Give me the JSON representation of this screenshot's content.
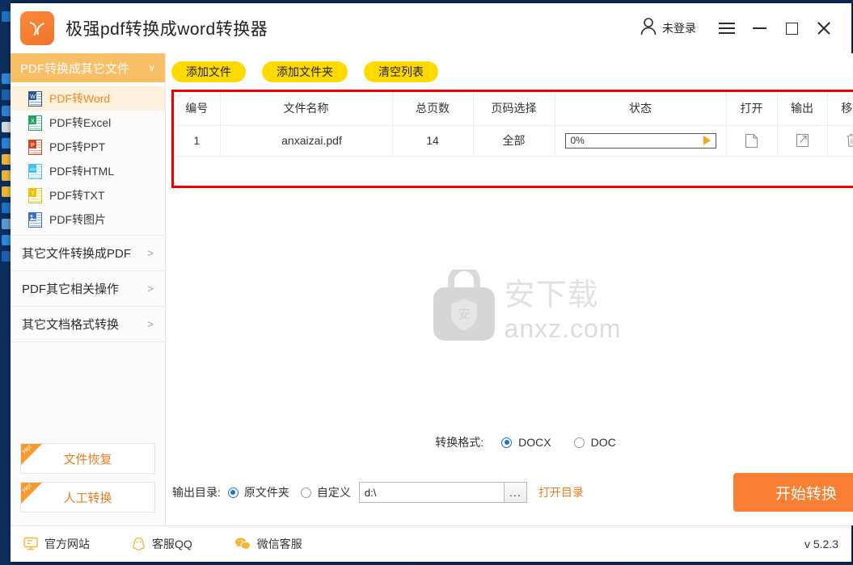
{
  "window": {
    "title": "极强pdf转换成word转换器",
    "login_text": "未登录",
    "version": "v 5.2.3"
  },
  "titlebar_controls": {
    "user_icon": "user-icon",
    "menu_icon": "hamburger-icon",
    "minimize_icon": "minimize-icon",
    "maximize_icon": "maximize-icon",
    "close_icon": "close-icon"
  },
  "sidebar": {
    "header": {
      "label": "PDF转换成其它文件",
      "chevron": "∨"
    },
    "sub_items": [
      {
        "label": "PDF转Word",
        "icon": "word-file-icon",
        "color": "#2b579a",
        "letter": "W",
        "active": true
      },
      {
        "label": "PDF转Excel",
        "icon": "excel-file-icon",
        "color": "#21a366",
        "letter": "X",
        "active": false
      },
      {
        "label": "PDF转PPT",
        "icon": "ppt-file-icon",
        "color": "#d24726",
        "letter": "P",
        "active": false
      },
      {
        "label": "PDF转HTML",
        "icon": "html-file-icon",
        "color": "#45c3f0",
        "letter": "<>",
        "active": false
      },
      {
        "label": "PDF转TXT",
        "icon": "txt-file-icon",
        "color": "#f2c200",
        "letter": "T",
        "active": false
      },
      {
        "label": "PDF转图片",
        "icon": "image-file-icon",
        "color": "#3a6fd8",
        "letter": "▣",
        "active": false
      }
    ],
    "groups": [
      {
        "label": "其它文件转换成PDF",
        "arrow": ">"
      },
      {
        "label": "PDF其它相关操作",
        "arrow": ">"
      },
      {
        "label": "其它文档格式转换",
        "arrow": ">"
      }
    ],
    "promos": [
      {
        "label": "文件恢复",
        "badge": "Hot"
      },
      {
        "label": "人工转换",
        "badge": "Hot"
      }
    ]
  },
  "toolbar": {
    "add_file": "添加文件",
    "add_folder": "添加文件夹",
    "clear_list": "清空列表"
  },
  "file_table": {
    "columns": [
      "编号",
      "文件名称",
      "总页数",
      "页码选择",
      "状态",
      "打开",
      "输出",
      "移出"
    ],
    "rows": [
      {
        "index": "1",
        "filename": "anxaizai.pdf",
        "pages": "14",
        "page_select": "全部",
        "status": "0%",
        "open_icon": "open-file-icon",
        "output_icon": "export-icon",
        "remove_icon": "trash-icon"
      }
    ]
  },
  "watermark": {
    "icon": "anxz-bag-logo",
    "text_cn": "安下载",
    "text_url": "anxz.com"
  },
  "format_row": {
    "label": "转换格式:",
    "options": [
      {
        "label": "DOCX",
        "selected": true
      },
      {
        "label": "DOC",
        "selected": false
      }
    ]
  },
  "output_row": {
    "label": "输出目录:",
    "options": [
      {
        "label": "原文件夹",
        "selected": true
      },
      {
        "label": "自定义",
        "selected": false
      }
    ],
    "path_value": "d:\\",
    "browse_label": "...",
    "open_dir_label": "打开目录",
    "start_label": "开始转换"
  },
  "status_bar": {
    "items": [
      {
        "label": "官方网站",
        "icon": "monitor-icon"
      },
      {
        "label": "客服QQ",
        "icon": "qq-penguin-icon"
      },
      {
        "label": "微信客服",
        "icon": "wechat-icon"
      }
    ]
  },
  "colors": {
    "accent_orange": "#f07c1e",
    "header_orange": "#f9bf66",
    "button_yellow": "#ffd900",
    "start_orange": "#f97f32",
    "highlight_red": "#ef0000",
    "desktop_blue": "#0d3163"
  }
}
